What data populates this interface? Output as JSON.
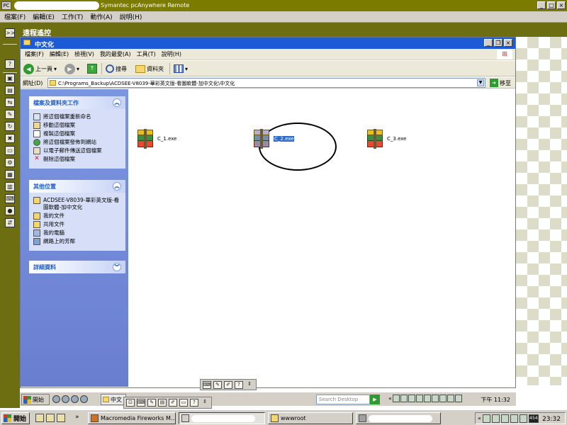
{
  "outer": {
    "title": "Symantec pcAnywhere Remote",
    "app_icon_glyph": "PC",
    "menu": [
      "檔案(F)",
      "編輯(E)",
      "工作(T)",
      "動作(A)",
      "說明(H)"
    ],
    "window_controls": {
      "minimize": "_",
      "maximize": "□",
      "close": "×"
    }
  },
  "remote": {
    "header_title": "遠程遙控",
    "expand_glyph": ">>"
  },
  "explorer": {
    "title": "中文化",
    "menu": [
      "檔案(F)",
      "編輯(E)",
      "檢視(V)",
      "我的最愛(A)",
      "工具(T)",
      "說明(H)"
    ],
    "window_controls": {
      "minimize": "_",
      "restore": "❐",
      "close": "×"
    },
    "toolbar": {
      "back_label": "上一頁",
      "search_label": "搜尋",
      "folders_label": "資料夾"
    },
    "address": {
      "label": "網址(D)",
      "path": "C:\\Programs_Backup\\ACDSEE-V8039-華彩英文版-看圖軟體-加中文化\\中文化",
      "go_label": "移至"
    },
    "task_pane": {
      "file_tasks": {
        "title": "檔案及資料夾工作",
        "items": [
          "將這個檔案重新命名",
          "移動這個檔案",
          "複製這個檔案",
          "將這個檔案發佈到網站",
          "以電子郵件傳送這個檔案",
          "刪除這個檔案"
        ]
      },
      "other_places": {
        "title": "其他位置",
        "items": [
          "ACDSEE-V8039-華彩英文版-看圖軟體-加中文化",
          "我的文件",
          "共用文件",
          "我的電腦",
          "網路上的芳鄰"
        ]
      },
      "details": {
        "title": "詳細資料"
      }
    },
    "files": [
      {
        "name": "C_1.exe",
        "selected": false
      },
      {
        "name": "C_2.exe",
        "selected": true
      },
      {
        "name": "C_3.exe",
        "selected": false
      }
    ]
  },
  "remote_taskbar": {
    "start_label": "開始",
    "task_label": "中文",
    "search_placeholder": "Search Desktop",
    "clock": "下午 11:32"
  },
  "local_taskbar": {
    "start_label": "開始",
    "tasks": [
      "Macromedia Fireworks M...",
      "wwwroot"
    ],
    "tray_badge": "454",
    "clock": "23:32"
  }
}
